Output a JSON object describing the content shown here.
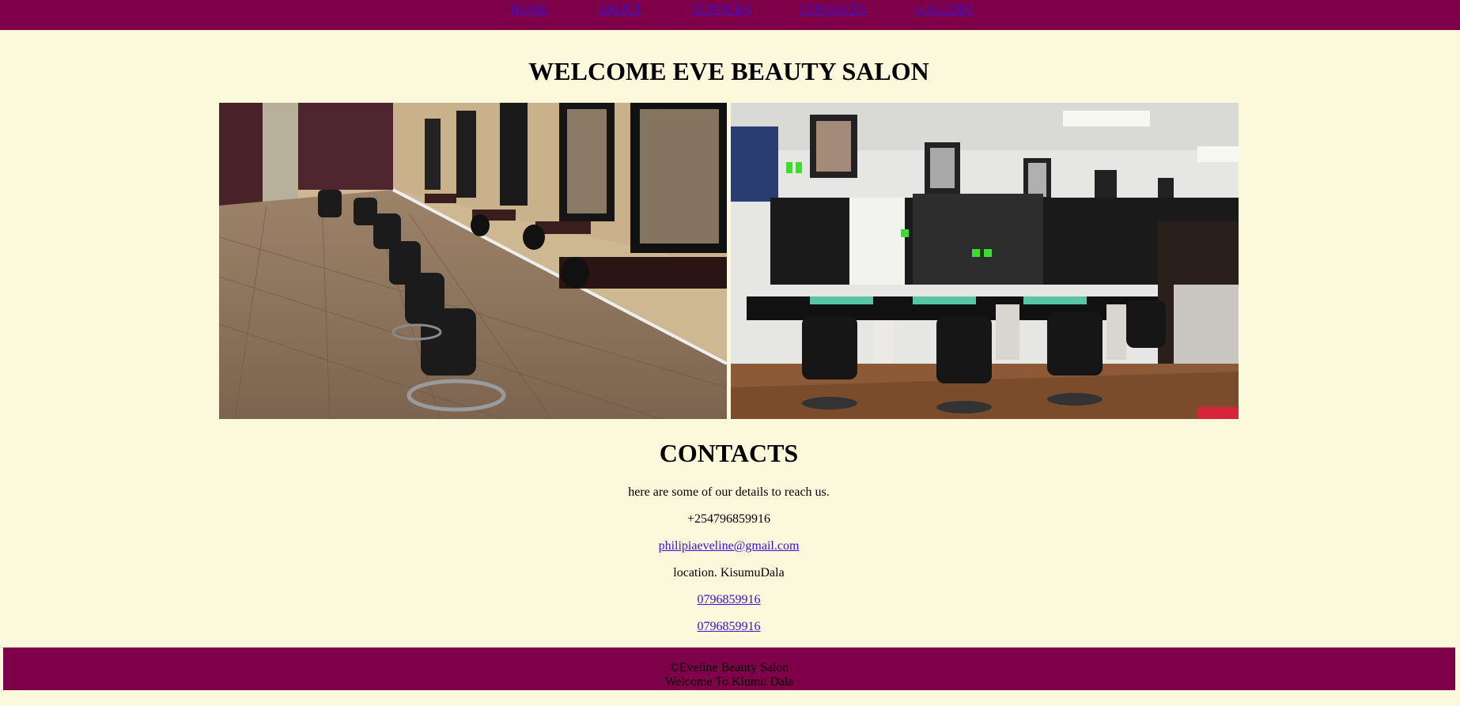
{
  "nav": {
    "items": [
      "HOME",
      "ABOUT",
      "SERVICES",
      "CONTACTS",
      "GALLERY"
    ]
  },
  "header": {
    "title": "WELCOME EVE BEAUTY SALON"
  },
  "gallery": {
    "images": [
      "salon-interior-photo-1",
      "salon-interior-photo-2"
    ]
  },
  "contacts": {
    "heading": "CONTACTS",
    "intro": "here are some of our details to reach us.",
    "phone": "+254796859916",
    "email": "philipiaeveline@gmail.com",
    "location": "location. KisumuDala",
    "link1": "0796859916",
    "link2": "0796859916"
  },
  "footer": {
    "copyright": "©Eveline Beauty Salon",
    "tagline": "Welcome To Kiumu Dala"
  },
  "colors": {
    "background": "#fcf8dc",
    "bar": "#7d0049",
    "link": "#3a0fd8"
  }
}
